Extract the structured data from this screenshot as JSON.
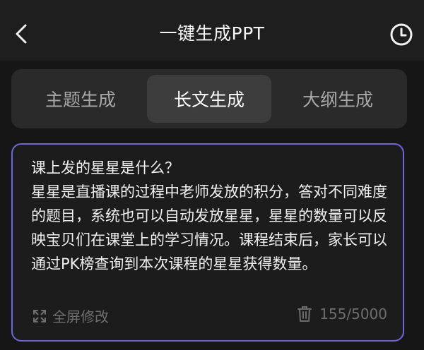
{
  "header": {
    "title": "一键生成PPT",
    "back_icon": "chevron-left-icon",
    "history_icon": "clock-icon"
  },
  "tabs": [
    {
      "label": "主题生成",
      "selected": false
    },
    {
      "label": "长文生成",
      "selected": true
    },
    {
      "label": "大纲生成",
      "selected": false
    }
  ],
  "editor": {
    "text": "课上发的星星是什么？\n星星是直播课的过程中老师发放的积分，答对不同难度的题目，系统也可以自动发放星星，星星的数量可以反映宝贝们在课堂上的学习情况。课程结束后，家长可以通过PK榜查询到本次课程的星星获得数量。",
    "fullscreen_label": "全屏修改",
    "char_count": "155/5000"
  },
  "colors": {
    "accent_border": "#6f66d8",
    "background": "#161616",
    "header_bg": "#1e1e1e",
    "tabs_bg": "#2a2a2a",
    "tab_selected_bg": "#3d3d3d"
  }
}
